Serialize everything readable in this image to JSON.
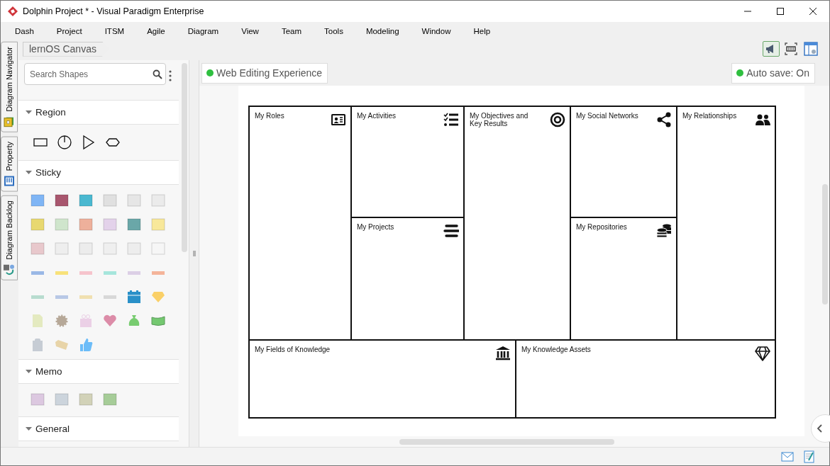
{
  "window": {
    "title": "Dolphin Project * - Visual Paradigm Enterprise"
  },
  "menu": [
    "Dash",
    "Project",
    "ITSM",
    "Agile",
    "Diagram",
    "View",
    "Team",
    "Tools",
    "Modeling",
    "Window",
    "Help"
  ],
  "side_tabs": [
    {
      "label": "Diagram Navigator"
    },
    {
      "label": "Property"
    },
    {
      "label": "Diagram Backlog"
    }
  ],
  "breadcrumb": {
    "label": "lernOS Canvas"
  },
  "toolbar": [
    {
      "kind": "announce",
      "selected": true
    },
    {
      "kind": "fit",
      "selected": false
    },
    {
      "kind": "layout",
      "selected": false
    }
  ],
  "palette": {
    "search": {
      "placeholder": "Search Shapes"
    },
    "sections": [
      {
        "title": "Region",
        "kind": "region",
        "expanded": true
      },
      {
        "title": "Sticky",
        "kind": "sticky",
        "expanded": true
      },
      {
        "title": "Memo",
        "kind": "memo",
        "expanded": true
      },
      {
        "title": "General",
        "kind": "general",
        "expanded": true
      }
    ]
  },
  "canvas": {
    "badges": [
      {
        "label": "Web Editing Experience"
      },
      {
        "label": "Auto save: On"
      }
    ],
    "board": {
      "cells": [
        {
          "title": "My Roles"
        },
        {
          "title": "My Activities"
        },
        {
          "title": "My Objectives and Key Results"
        },
        {
          "title": "My Social Networks"
        },
        {
          "title": "My Relationships"
        },
        {
          "title": "My Projects"
        },
        {
          "title": "My Repositories"
        },
        {
          "title": "My Fields of Knowledge"
        },
        {
          "title": "My Knowledge Assets"
        }
      ]
    }
  }
}
